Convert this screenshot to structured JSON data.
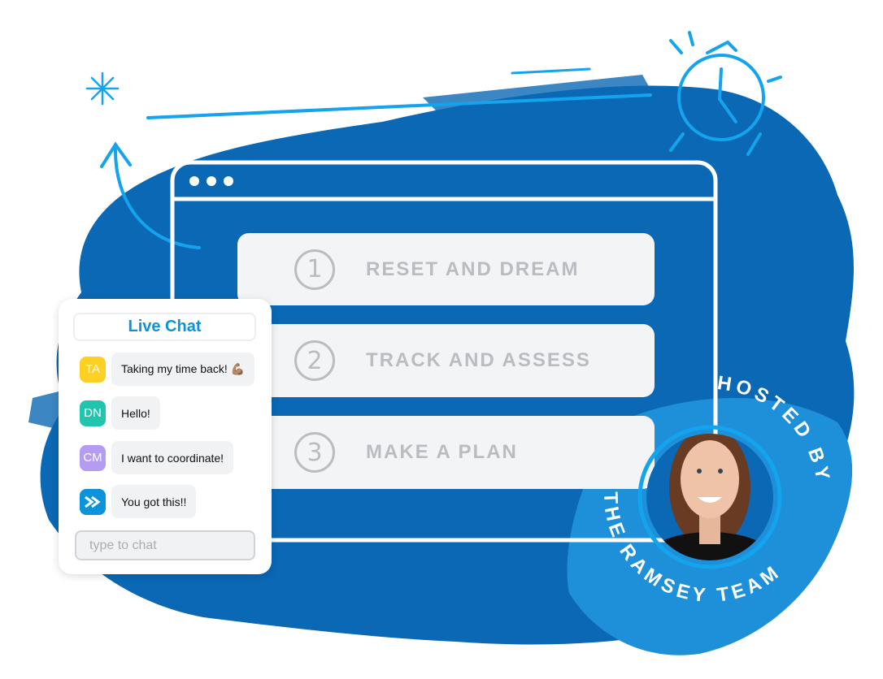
{
  "colors": {
    "brush_dark": "#0a68b4",
    "brush_light": "#1e90d9",
    "accent": "#14a4ee",
    "card_bg": "#f3f4f6",
    "card_text": "#b9bdc2"
  },
  "steps": [
    {
      "number": "1",
      "label": "RESET AND DREAM"
    },
    {
      "number": "2",
      "label": "TRACK AND ASSESS"
    },
    {
      "number": "3",
      "label": "MAKE A PLAN"
    }
  ],
  "chat": {
    "title": "Live Chat",
    "messages": [
      {
        "initials": "TA",
        "color": "#fdd023",
        "text": "Taking my time back! 💪🏽"
      },
      {
        "initials": "DN",
        "color": "#21c4ad",
        "text": "Hello!"
      },
      {
        "initials": "CM",
        "color": "#b59cf3",
        "text": "I want to coordinate!"
      },
      {
        "initials": "",
        "icon": "ramsey-logo-icon",
        "color": "#0b93dc",
        "text": "You got this!!"
      }
    ],
    "input_placeholder": "type to chat"
  },
  "host": {
    "badge_text": "HOSTED BY THE RAMSEY TEAM",
    "top_text": "HOSTED BY",
    "bottom_text": "THE RAMSEY TEAM"
  },
  "icons": [
    "sparkle-icon",
    "alarm-clock-icon",
    "curved-arrow-icon"
  ]
}
